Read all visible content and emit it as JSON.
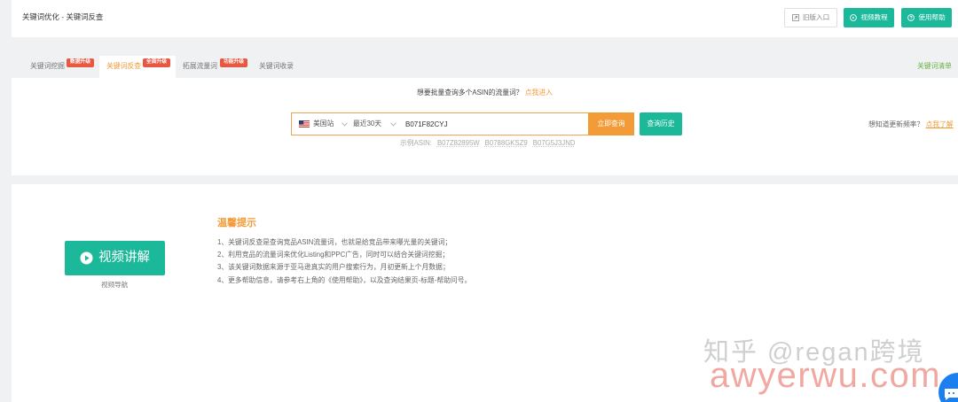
{
  "header": {
    "breadcrumb": "关键词优化 - 关键词反查",
    "old_version_label": "旧版入口",
    "video_tutorial_label": "视频教程",
    "help_label": "使用帮助",
    "icons": {
      "old_version": "external-box-icon",
      "video_tutorial": "play-circle-icon",
      "help": "question-circle-icon"
    }
  },
  "tabs": [
    {
      "label": "关键词挖掘",
      "badge": "数据升级",
      "active": false
    },
    {
      "label": "关键词反查",
      "badge": "全面升级",
      "active": true
    },
    {
      "label": "拓展流量词",
      "badge": "功能升级",
      "active": false
    },
    {
      "label": "关键词收录",
      "badge": "",
      "active": false
    }
  ],
  "tabs_right_link": "关键词清单",
  "search": {
    "batch_prompt": "想要批量查询多个ASIN的流量词？",
    "batch_link": "点我进入",
    "marketplace": "美国站",
    "marketplace_icon": "us-flag-icon",
    "period": "最近30天",
    "asin_value": "B071F82CYJ",
    "submit_label": "立即查询",
    "history_label": "查询历史",
    "example_label": "示例ASIN:",
    "examples": [
      "B07Z82895W",
      "B0788GKSZ9",
      "B07G5J3JND"
    ],
    "update_prompt": "想知道更新频率？",
    "update_link": "点我了解"
  },
  "video": {
    "button_label": "视频讲解",
    "button_icon": "play-circle-icon",
    "nav_label": "视频导航"
  },
  "tips": {
    "title": "温馨提示",
    "items": [
      "1、关键词反查是查询竞品ASIN流量词，也就是给竞品带来曝光量的关键词；",
      "2、利用竞品的流量词来优化Listing和PPC广告，同时可以结合关键词挖掘；",
      "3、该关键词数据来源于亚马逊真实的用户搜索行为，月初更新上个月数据；",
      "4、更多帮助信息，请参考右上角的《使用帮助》，以及查询结果页-标题-帮助问号。"
    ]
  },
  "watermark": {
    "line1": "知乎 @regan跨境",
    "line2": "awyerwu.com"
  },
  "chat_icon": "chat-bubble-icon",
  "colors": {
    "teal": "#1bb99a",
    "orange": "#f29b37",
    "badge_red": "#e8573f",
    "link_green": "#6ab344",
    "page_bg": "#f0f1f3"
  }
}
